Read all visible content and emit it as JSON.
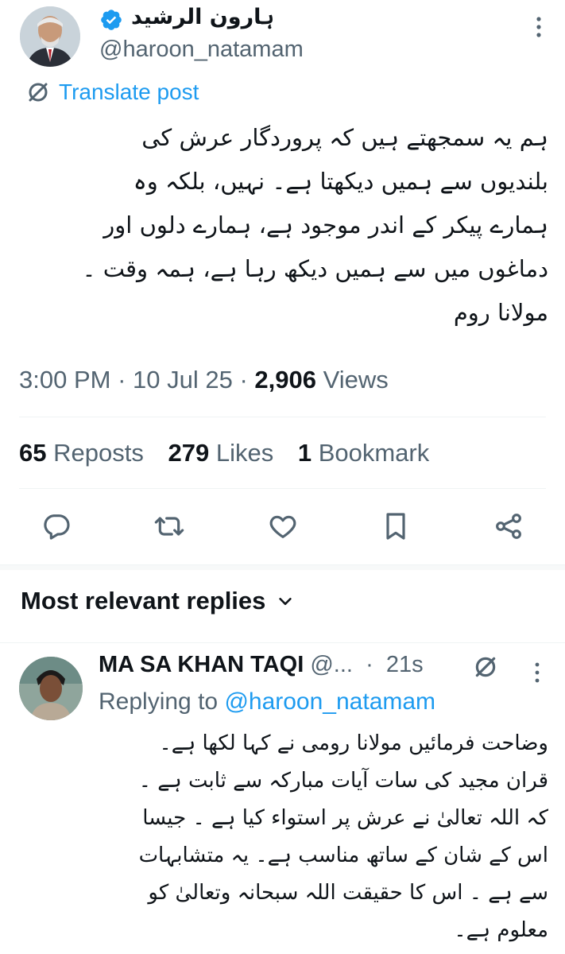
{
  "post": {
    "author_name": "ہارون الرشید",
    "handle": "@haroon_natamam",
    "translate_label": "Translate post",
    "text_lines": [
      "ہم یہ سمجھتے ہیں کہ پروردگار عرش کی",
      "بلندیوں سے ہمیں دیکھتا ہے۔ نہیں، بلکہ وہ",
      "ہمارے پیکر کے اندر موجود ہے، ہمارے دلوں اور",
      "دماغوں میں سے ہمیں دیکھ رہا ہے، ہمہ وقت ۔",
      "مولانا روم"
    ],
    "time": "3:00 PM",
    "date": "10 Jul 25",
    "views_count": "2,906",
    "views_label": "Views",
    "reposts_count": "65",
    "reposts_label": "Reposts",
    "likes_count": "279",
    "likes_label": "Likes",
    "bookmarks_count": "1",
    "bookmarks_label": "Bookmark"
  },
  "replies": {
    "header": "Most relevant replies",
    "items": [
      {
        "name": "MA SA KHAN TAQI",
        "handle_truncated": "@...",
        "time": "21s",
        "replying_prefix": "Replying to",
        "replying_handle": "@haroon_natamam",
        "text_lines": [
          "وضاحت فرمائیں مولانا رومی نے کہا لکھا ہے۔",
          "قران مجید کی سات آیات مبارکہ سے ثابت ہے ۔",
          "کہ اللہ تعالیٰ نے عرش پر استواء کیا ہے ۔ جیسا",
          "اس کے شان کے ساتھ مناسب ہے۔ یہ متشابہات",
          "سے ہے ۔ اس کا حقیقت اللہ سبحانہ وتعالیٰ کو",
          "معلوم ہے۔"
        ]
      }
    ]
  },
  "colors": {
    "accent": "#1d9bf0",
    "muted": "#536471",
    "text": "#0f1419"
  },
  "icons": [
    "verified-badge-icon",
    "more-icon",
    "translate-icon",
    "reply-icon",
    "repost-icon",
    "like-icon",
    "bookmark-icon",
    "share-icon",
    "chevron-down-icon",
    "grok-icon"
  ]
}
